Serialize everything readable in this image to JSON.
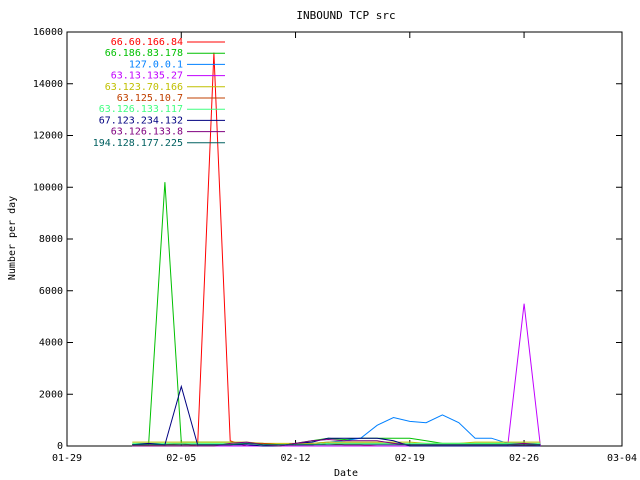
{
  "chart_data": {
    "type": "line",
    "title": "INBOUND TCP src",
    "xlabel": "Date",
    "ylabel": "Number per day",
    "xlim": [
      "2003-01-29",
      "2003-03-04"
    ],
    "ylim": [
      0,
      16000
    ],
    "x_ticks": [
      {
        "date": "2003-01-29",
        "label": "01-29"
      },
      {
        "date": "2003-02-05",
        "label": "02-05"
      },
      {
        "date": "2003-02-12",
        "label": "02-12"
      },
      {
        "date": "2003-02-19",
        "label": "02-19"
      },
      {
        "date": "2003-02-26",
        "label": "02-26"
      },
      {
        "date": "2003-03-04",
        "label": "03-04"
      }
    ],
    "y_ticks": [
      0,
      2000,
      4000,
      6000,
      8000,
      10000,
      12000,
      14000,
      16000
    ],
    "legend_position": "top-left",
    "grid": false,
    "x": [
      "2003-02-02",
      "2003-02-03",
      "2003-02-04",
      "2003-02-05",
      "2003-02-06",
      "2003-02-07",
      "2003-02-08",
      "2003-02-09",
      "2003-02-10",
      "2003-02-11",
      "2003-02-12",
      "2003-02-13",
      "2003-02-14",
      "2003-02-15",
      "2003-02-16",
      "2003-02-17",
      "2003-02-18",
      "2003-02-19",
      "2003-02-20",
      "2003-02-21",
      "2003-02-22",
      "2003-02-23",
      "2003-02-24",
      "2003-02-25",
      "2003-02-26",
      "2003-02-27"
    ],
    "series": [
      {
        "name": "66.60.166.84",
        "color": "#ff0000",
        "values": [
          50,
          50,
          50,
          100,
          0,
          15200,
          200,
          0,
          0,
          0,
          50,
          50,
          100,
          50,
          50,
          0,
          0,
          0,
          0,
          0,
          0,
          0,
          0,
          0,
          50,
          0
        ]
      },
      {
        "name": "66.186.83.178",
        "color": "#00c000",
        "values": [
          50,
          50,
          10200,
          150,
          150,
          150,
          150,
          100,
          100,
          0,
          100,
          200,
          300,
          250,
          300,
          300,
          300,
          300,
          200,
          100,
          100,
          100,
          100,
          100,
          100,
          50
        ]
      },
      {
        "name": "127.0.0.1",
        "color": "#0080ff",
        "values": [
          0,
          0,
          0,
          0,
          0,
          0,
          0,
          0,
          0,
          0,
          0,
          100,
          150,
          200,
          300,
          800,
          1100,
          950,
          900,
          1200,
          900,
          300,
          300,
          100,
          100,
          50
        ]
      },
      {
        "name": "63.13.135.27",
        "color": "#c000ff",
        "values": [
          0,
          0,
          0,
          0,
          0,
          0,
          0,
          0,
          0,
          0,
          0,
          0,
          0,
          0,
          0,
          0,
          0,
          0,
          0,
          0,
          0,
          0,
          0,
          0,
          5500,
          0
        ]
      },
      {
        "name": "63.123.70.166",
        "color": "#c0c000",
        "values": [
          150,
          150,
          150,
          150,
          150,
          150,
          150,
          150,
          100,
          100,
          100,
          100,
          150,
          150,
          150,
          150,
          150,
          150,
          100,
          100,
          100,
          150,
          150,
          150,
          150,
          150
        ]
      },
      {
        "name": "63.125.10.7",
        "color": "#c04000",
        "values": [
          50,
          50,
          50,
          50,
          50,
          50,
          50,
          100,
          100,
          50,
          50,
          50,
          100,
          100,
          100,
          100,
          100,
          50,
          50,
          50,
          50,
          50,
          50,
          50,
          50,
          50
        ]
      },
      {
        "name": "63.126.133.117",
        "color": "#40ff80",
        "values": [
          100,
          100,
          100,
          100,
          100,
          100,
          100,
          100,
          50,
          50,
          50,
          50,
          100,
          100,
          100,
          100,
          100,
          100,
          100,
          100,
          100,
          100,
          100,
          100,
          100,
          100
        ]
      },
      {
        "name": "67.123.234.132",
        "color": "#000080",
        "values": [
          50,
          100,
          50,
          2300,
          50,
          50,
          50,
          50,
          0,
          0,
          100,
          150,
          300,
          300,
          300,
          300,
          200,
          0,
          0,
          0,
          0,
          0,
          0,
          0,
          0,
          0
        ]
      },
      {
        "name": "63.126.133.8",
        "color": "#800080",
        "values": [
          0,
          0,
          0,
          0,
          0,
          0,
          100,
          150,
          50,
          0,
          100,
          200,
          250,
          200,
          200,
          200,
          100,
          50,
          50,
          50,
          50,
          50,
          50,
          50,
          100,
          50
        ]
      },
      {
        "name": "194.128.177.225",
        "color": "#006060",
        "values": [
          50,
          50,
          50,
          50,
          50,
          50,
          50,
          100,
          50,
          50,
          50,
          50,
          50,
          50,
          50,
          50,
          50,
          50,
          50,
          50,
          50,
          50,
          50,
          50,
          50,
          50
        ]
      }
    ]
  }
}
